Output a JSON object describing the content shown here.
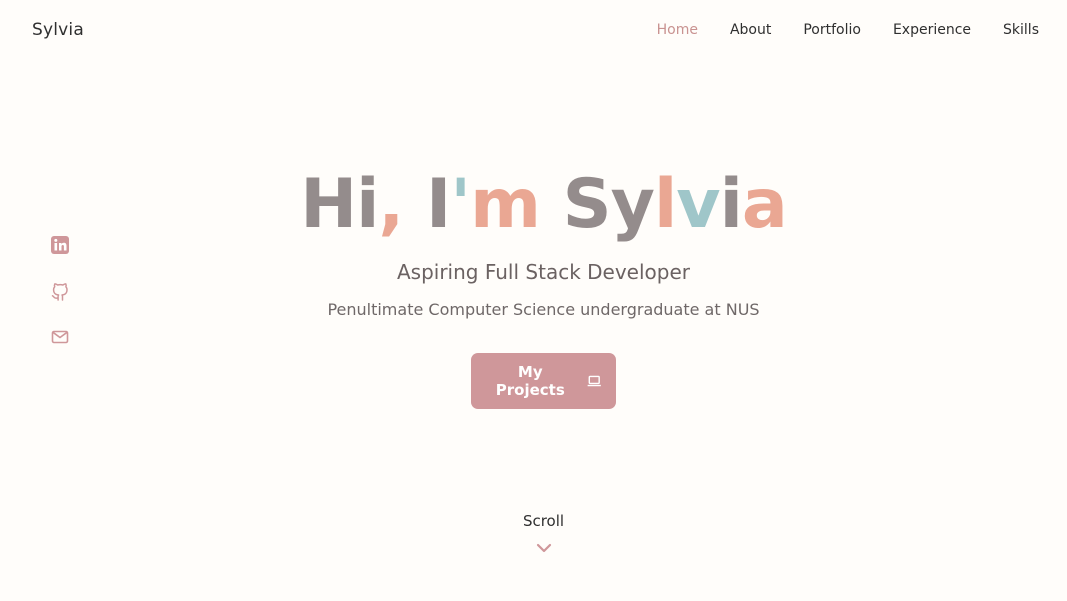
{
  "header": {
    "brand": "Sylvia",
    "nav": [
      {
        "label": "Home",
        "active": true
      },
      {
        "label": "About",
        "active": false
      },
      {
        "label": "Portfolio",
        "active": false
      },
      {
        "label": "Experience",
        "active": false
      },
      {
        "label": "Skills",
        "active": false
      }
    ]
  },
  "social": [
    {
      "icon": "linkedin-icon"
    },
    {
      "icon": "github-icon"
    },
    {
      "icon": "mail-icon"
    }
  ],
  "hero": {
    "title_parts": {
      "hi": "Hi",
      "comma": ",",
      "i": "I",
      "apostrophe": "'",
      "m": "m",
      "sy": "Sy",
      "l": "l",
      "v": "v",
      "i2": "i",
      "a": "a"
    },
    "subtitle": "Aspiring Full Stack Developer",
    "description": "Penultimate Computer Science undergraduate at NUS",
    "cta_label": "My Projects",
    "cta_icon": "laptop-icon"
  },
  "scroll": {
    "label": "Scroll",
    "icon": "chevron-down-icon"
  },
  "colors": {
    "accent": "#cf979a",
    "peach": "#eaa793",
    "teal": "#9fc6c9",
    "grey": "#948c8c",
    "background": "#fffdfa"
  }
}
